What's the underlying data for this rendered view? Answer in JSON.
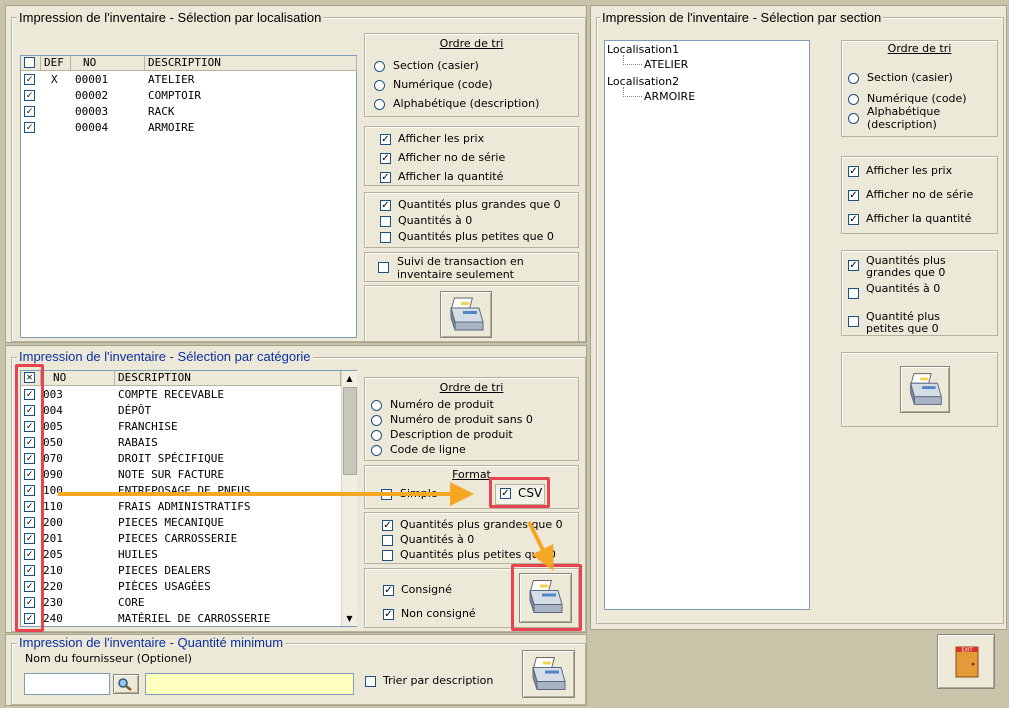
{
  "loc": {
    "title": "Impression de l'inventaire - Sélection par localisation",
    "headers": {
      "def": "DEF",
      "no": "NO",
      "desc": "DESCRIPTION"
    },
    "rows": [
      {
        "def": "X",
        "no": "00001",
        "desc": "ATELIER",
        "checked": true
      },
      {
        "def": "",
        "no": "00002",
        "desc": "COMPTOIR",
        "checked": true
      },
      {
        "def": "",
        "no": "00003",
        "desc": "RACK",
        "checked": true
      },
      {
        "def": "",
        "no": "00004",
        "desc": "ARMOIRE",
        "checked": true
      }
    ],
    "sort_title": "Ordre de tri",
    "sort": [
      "Section (casier)",
      "Numérique (code)",
      "Alphabétique (description)"
    ],
    "show": [
      "Afficher les prix",
      "Afficher no de série",
      "Afficher la quantité"
    ],
    "qty": [
      "Quantités plus grandes que 0",
      "Quantités à 0",
      "Quantités plus petites que 0"
    ],
    "tracking": "Suivi de transaction en inventaire seulement"
  },
  "cat": {
    "title": "Impression de l'inventaire - Sélection par catégorie",
    "headers": {
      "no": "NO",
      "desc": "DESCRIPTION"
    },
    "rows": [
      {
        "no": "003",
        "desc": "COMPTE RECEVABLE"
      },
      {
        "no": "004",
        "desc": "DÉPÔT"
      },
      {
        "no": "005",
        "desc": "FRANCHISE"
      },
      {
        "no": "050",
        "desc": "RABAIS"
      },
      {
        "no": "070",
        "desc": "DROIT SPÉCIFIQUE"
      },
      {
        "no": "090",
        "desc": "NOTE SUR FACTURE"
      },
      {
        "no": "100",
        "desc": "ENTREPOSAGE DE PNEUS"
      },
      {
        "no": "110",
        "desc": "FRAIS ADMINISTRATIFS"
      },
      {
        "no": "200",
        "desc": "PIECES MECANIQUE"
      },
      {
        "no": "201",
        "desc": "PIECES CARROSSERIE"
      },
      {
        "no": "205",
        "desc": "HUILES"
      },
      {
        "no": "210",
        "desc": "PIECES DEALERS"
      },
      {
        "no": "220",
        "desc": "PIÈCES USAGÉES"
      },
      {
        "no": "230",
        "desc": "CORE"
      },
      {
        "no": "240",
        "desc": "MATÉRIEL DE CARROSSERIE"
      }
    ],
    "sort_title": "Ordre de tri",
    "sort": [
      "Numéro de produit",
      "Numéro de produit sans 0",
      "Description de produit",
      "Code de ligne"
    ],
    "format_title": "Format",
    "format_simple": "Simple",
    "format_simple_suffix": "e",
    "format_csv": "CSV",
    "qty": [
      "Quantités plus grandes que 0",
      "Quantités à 0",
      "Quantités plus petites que 0"
    ],
    "consign": [
      "Consigné",
      "Non consigné"
    ]
  },
  "min": {
    "title": "Impression de l'inventaire - Quantité minimum",
    "supplier_label": "Nom du fournisseur (Optionel)",
    "supplier_value": "",
    "sort_desc": "Trier par description"
  },
  "sec": {
    "title": "Impression de l'inventaire - Sélection par section",
    "tree": [
      {
        "label": "Localisation1",
        "child": "ATELIER"
      },
      {
        "label": "Localisation2",
        "child": "ARMOIRE"
      }
    ],
    "sort_title": "Ordre de tri",
    "sort": [
      "Section (casier)",
      "Numérique (code)",
      "Alphabétique (description)"
    ],
    "show": [
      "Afficher les prix",
      "Afficher no de série",
      "Afficher la quantité"
    ],
    "qty": [
      "Quantités plus grandes que 0",
      "Quantités à 0",
      "Quantité plus petites que 0"
    ]
  },
  "exit_label": "EXIT",
  "colors": {
    "highlight": "#e8444f",
    "arrow": "#f5a623",
    "title_blue": "#0b2ea3"
  }
}
